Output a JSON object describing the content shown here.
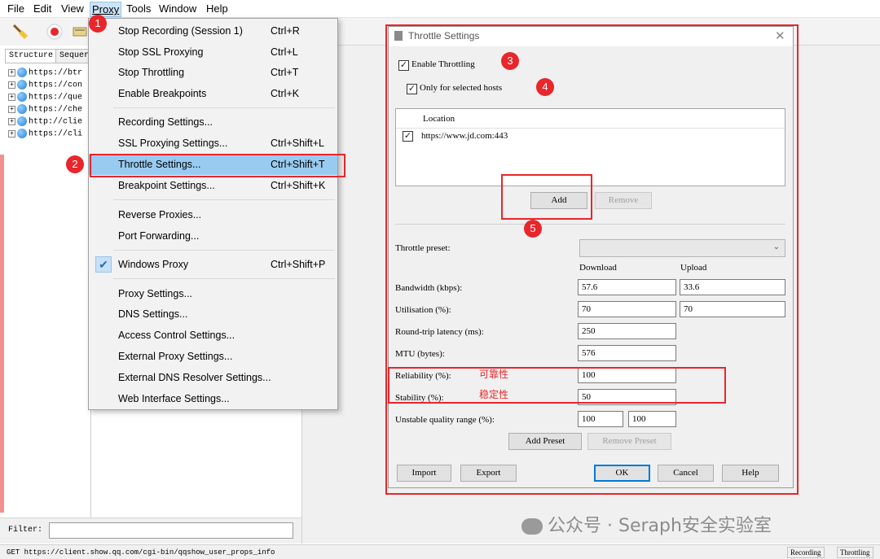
{
  "menubar": {
    "items": [
      "File",
      "Edit",
      "View",
      "Proxy",
      "Tools",
      "Window",
      "Help"
    ]
  },
  "left_pane": {
    "tabs": [
      "Structure",
      "Sequer"
    ],
    "tree": [
      "https://btr",
      "https://con",
      "https://que",
      "https://che",
      "http://clie",
      "https://cli"
    ]
  },
  "filter": {
    "label": "Filter:"
  },
  "statusbar": {
    "url": "GET https://client.show.qq.com/cgi-bin/qqshow_user_props_info",
    "recording": "Recording",
    "throttling": "Throttling"
  },
  "proxy_menu": {
    "items": [
      {
        "label": "Stop Recording (Session 1)",
        "shortcut": "Ctrl+R"
      },
      {
        "label": "Stop SSL Proxying",
        "shortcut": "Ctrl+L"
      },
      {
        "label": "Stop Throttling",
        "shortcut": "Ctrl+T"
      },
      {
        "label": "Enable Breakpoints",
        "shortcut": "Ctrl+K"
      },
      {
        "label": "Recording Settings...",
        "shortcut": ""
      },
      {
        "label": "SSL Proxying Settings...",
        "shortcut": "Ctrl+Shift+L"
      },
      {
        "label": "Throttle Settings...",
        "shortcut": "Ctrl+Shift+T"
      },
      {
        "label": "Breakpoint Settings...",
        "shortcut": "Ctrl+Shift+K"
      },
      {
        "label": "Reverse Proxies...",
        "shortcut": ""
      },
      {
        "label": "Port Forwarding...",
        "shortcut": ""
      },
      {
        "label": "Windows Proxy",
        "shortcut": "Ctrl+Shift+P"
      },
      {
        "label": "Proxy Settings...",
        "shortcut": ""
      },
      {
        "label": "DNS Settings...",
        "shortcut": ""
      },
      {
        "label": "Access Control Settings...",
        "shortcut": ""
      },
      {
        "label": "External Proxy Settings...",
        "shortcut": ""
      },
      {
        "label": "External DNS Resolver Settings...",
        "shortcut": ""
      },
      {
        "label": "Web Interface Settings...",
        "shortcut": ""
      }
    ],
    "windows_proxy_checked": true
  },
  "dialog": {
    "title": "Throttle Settings",
    "enable_throttling": "Enable Throttling",
    "only_selected_hosts": "Only for selected hosts",
    "location_header": "Location",
    "locations": [
      "https://www.jd.com:443"
    ],
    "add": "Add",
    "remove": "Remove",
    "preset_label": "Throttle preset:",
    "preset_value": "",
    "col_download": "Download",
    "col_upload": "Upload",
    "bandwidth_label": "Bandwidth (kbps):",
    "bandwidth_down": "57.6",
    "bandwidth_up": "33.6",
    "utilisation_label": "Utilisation (%):",
    "utilisation_down": "70",
    "utilisation_up": "70",
    "latency_label": "Round-trip latency (ms):",
    "latency": "250",
    "mtu_label": "MTU (bytes):",
    "mtu": "576",
    "reliability_label": "Reliability (%):",
    "reliability": "100",
    "stability_label": "Stability (%):",
    "stability": "50",
    "unstable_label": "Unstable quality range (%):",
    "unstable_min": "100",
    "unstable_max": "100",
    "add_preset": "Add Preset",
    "remove_preset": "Remove Preset",
    "import": "Import",
    "export": "Export",
    "ok": "OK",
    "cancel": "Cancel",
    "help": "Help"
  },
  "annotations": {
    "badges": [
      "1",
      "2",
      "3",
      "4",
      "5"
    ],
    "reliability_note": "可靠性",
    "stability_note": "稳定性",
    "color": "#e8262b"
  },
  "watermark": "公众号 · Seraph安全实验室"
}
